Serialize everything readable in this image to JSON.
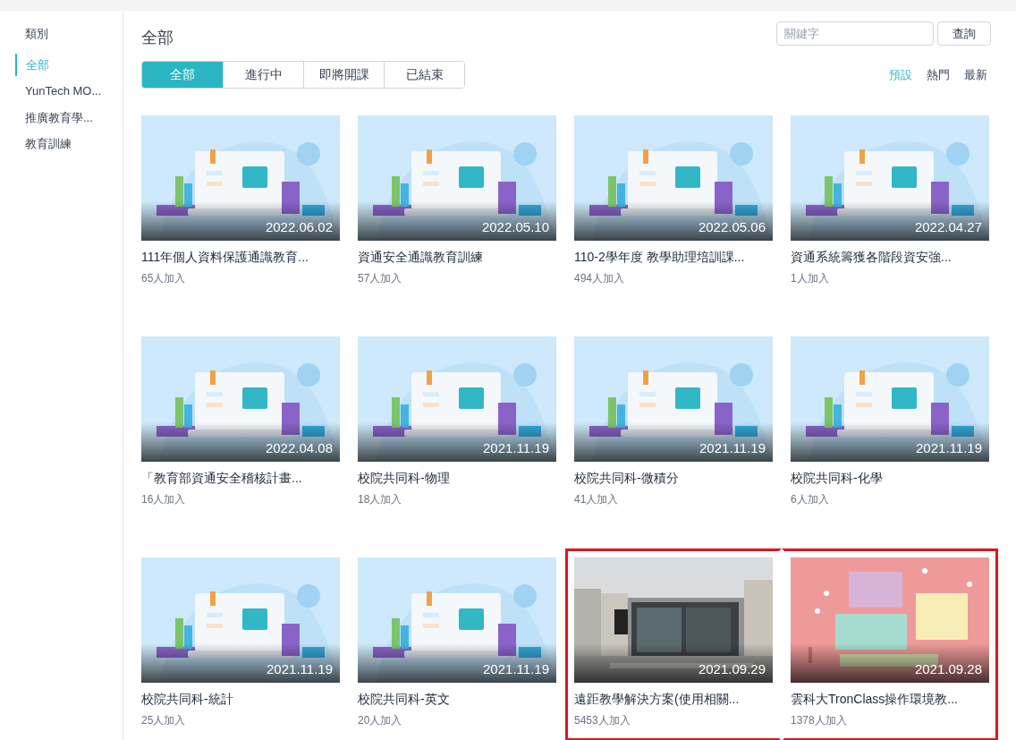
{
  "sidebar": {
    "heading": "類別",
    "items": [
      {
        "label": "全部",
        "selected": true
      },
      {
        "label": "YunTech MO...",
        "selected": false
      },
      {
        "label": "推廣教育學...",
        "selected": false
      },
      {
        "label": "教育訓練",
        "selected": false
      }
    ]
  },
  "page_title": "全部",
  "search": {
    "placeholder": "關鍵字",
    "button": "查詢"
  },
  "tabs": [
    {
      "label": "全部",
      "selected": true
    },
    {
      "label": "進行中",
      "selected": false
    },
    {
      "label": "即將開課",
      "selected": false
    },
    {
      "label": "已結束",
      "selected": false
    }
  ],
  "sort_options": [
    {
      "label": "預設",
      "selected": true
    },
    {
      "label": "熱門",
      "selected": false
    },
    {
      "label": "最新",
      "selected": false
    }
  ],
  "courses": [
    {
      "kind": "default",
      "date": "2022.06.02",
      "title": "111年個人資料保護通識教育...",
      "joined": "65人加入",
      "highlighted": false
    },
    {
      "kind": "default",
      "date": "2022.05.10",
      "title": "資通安全通識教育訓練",
      "joined": "57人加入",
      "highlighted": false
    },
    {
      "kind": "default",
      "date": "2022.05.06",
      "title": "110-2學年度 教學助理培訓課...",
      "joined": "494人加入",
      "highlighted": false
    },
    {
      "kind": "default",
      "date": "2022.04.27",
      "title": "資通系統籌獲各階段資安強...",
      "joined": "1人加入",
      "highlighted": false
    },
    {
      "kind": "default",
      "date": "2022.04.08",
      "title": "「教育部資通安全稽核計畫...",
      "joined": "16人加入",
      "highlighted": false
    },
    {
      "kind": "default",
      "date": "2021.11.19",
      "title": "校院共同科-物理",
      "joined": "18人加入",
      "highlighted": false
    },
    {
      "kind": "default",
      "date": "2021.11.19",
      "title": "校院共同科-微積分",
      "joined": "41人加入",
      "highlighted": false
    },
    {
      "kind": "default",
      "date": "2021.11.19",
      "title": "校院共同科-化學",
      "joined": "6人加入",
      "highlighted": false
    },
    {
      "kind": "default",
      "date": "2021.11.19",
      "title": "校院共同科-統計",
      "joined": "25人加入",
      "highlighted": false
    },
    {
      "kind": "default",
      "date": "2021.11.19",
      "title": "校院共同科-英文",
      "joined": "20人加入",
      "highlighted": false
    },
    {
      "date": "2021.09.29",
      "title": "遠距教學解決方案(使用相關...",
      "joined": "5453人加入",
      "highlighted": true
    },
    {
      "kind": "poster",
      "date": "2021.09.28",
      "title": "雲科大TronClass操作環境教...",
      "joined": "1378人加入",
      "highlighted": true
    }
  ]
}
